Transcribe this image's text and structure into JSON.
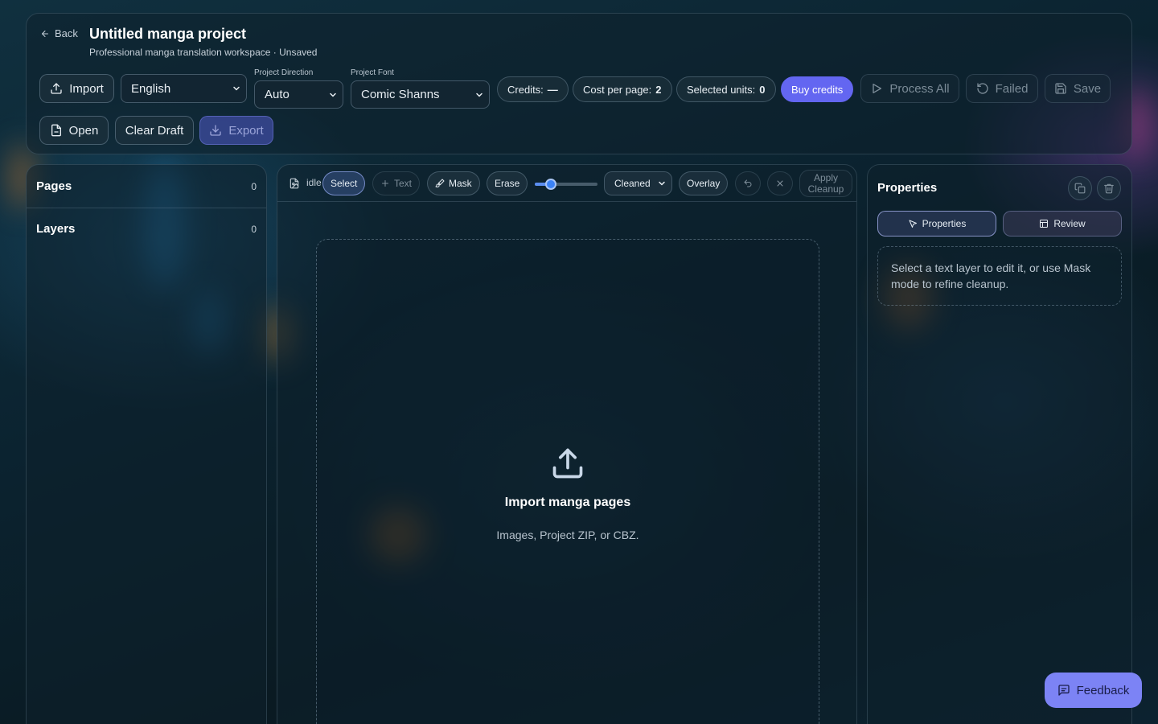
{
  "header": {
    "back_label": "Back",
    "title": "Untitled manga project",
    "subtitle": "Professional manga translation workspace · Unsaved",
    "import_label": "Import",
    "language_value": "English",
    "direction_label": "Project Direction",
    "direction_value": "Auto",
    "font_label": "Project Font",
    "font_value": "Comic Shanns",
    "credits_label": "Credits:",
    "credits_value": "—",
    "cost_label": "Cost per page:",
    "cost_value": "2",
    "units_label": "Selected units:",
    "units_value": "0",
    "buy_credits_label": "Buy credits",
    "process_all_label": "Process All",
    "failed_label": "Failed",
    "save_label": "Save",
    "open_label": "Open",
    "clear_draft_label": "Clear Draft",
    "export_label": "Export"
  },
  "left_panel": {
    "pages_label": "Pages",
    "pages_count": "0",
    "layers_label": "Layers",
    "layers_count": "0"
  },
  "toolbar": {
    "status": "idle",
    "select_label": "Select",
    "text_label": "Text",
    "mask_label": "Mask",
    "erase_label": "Erase",
    "brush_size_fraction": 0.25,
    "view_value": "Cleaned",
    "overlay_label": "Overlay",
    "apply_cleanup_label": "Apply Cleanup"
  },
  "canvas": {
    "dropzone_title": "Import manga pages",
    "dropzone_subtitle": "Images, Project ZIP, or CBZ."
  },
  "right_panel": {
    "title": "Properties",
    "tab_properties": "Properties",
    "tab_review": "Review",
    "hint": "Select a text layer to edit it, or use Mask mode to refine cleanup."
  },
  "feedback_label": "Feedback",
  "colors": {
    "accent": "#6366f1",
    "feedback": "#7c83f5"
  }
}
